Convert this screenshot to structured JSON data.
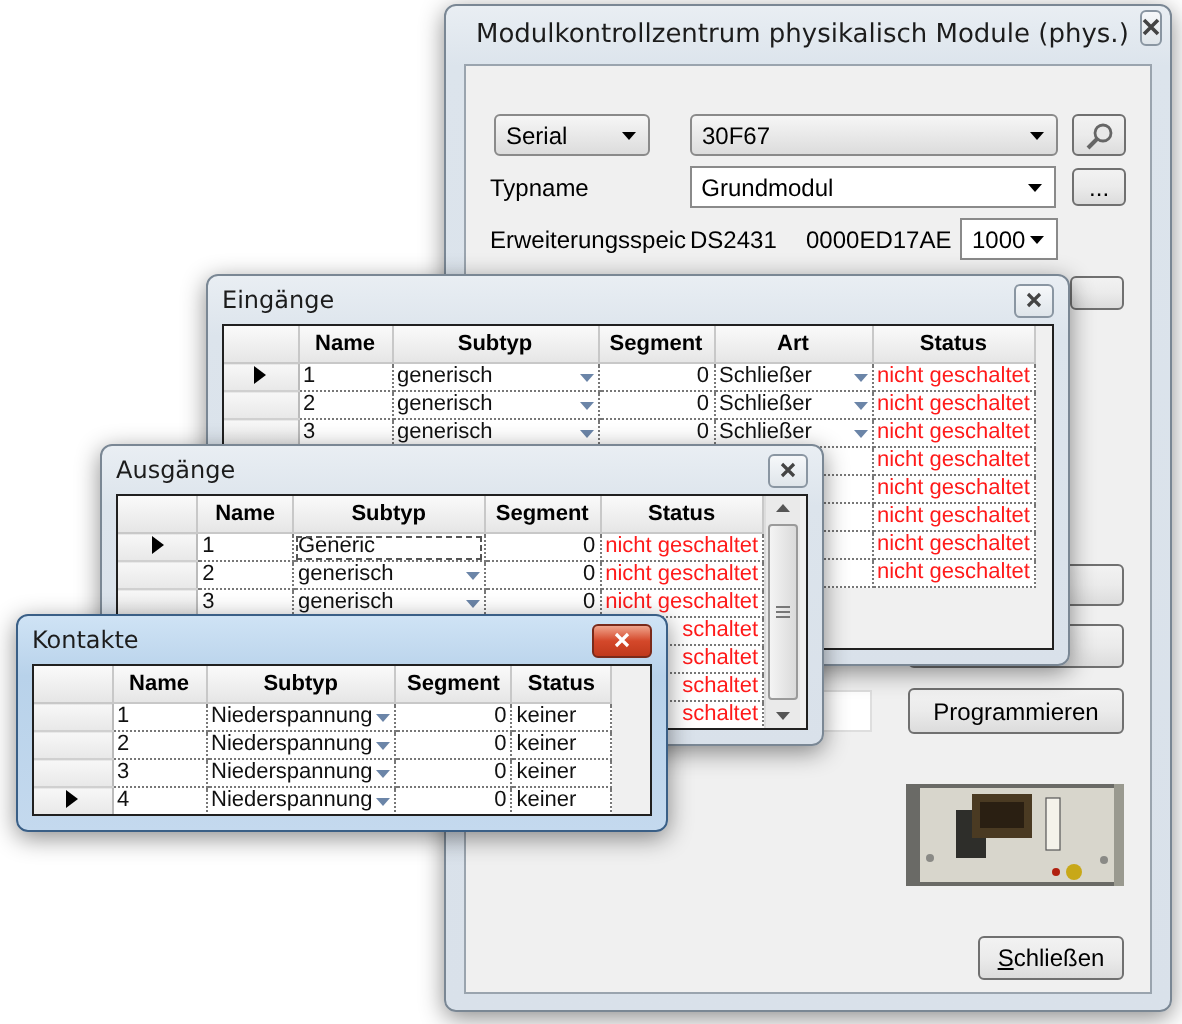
{
  "main_window": {
    "title": "Modulkontrollzentrum physikalisch Module (phys.)",
    "active": false,
    "interface_combo": "Serial",
    "serial_combo": "30F67",
    "typname_label": "Typname",
    "typname_combo": "Grundmodul",
    "browse_button": "...",
    "memory_label": "Erweiterungsspeic",
    "memory_chip": "DS2431",
    "memory_id": "0000ED17AE",
    "memory_size_combo": "1000",
    "program_button": "Programmieren",
    "close_button": "Schließen"
  },
  "windows": [
    {
      "kind": "inputs",
      "title": "Eingänge",
      "active": false,
      "status_alert": true,
      "columns": [
        {
          "label": "Name",
          "kind": "text"
        },
        {
          "label": "Subtyp",
          "kind": "combo"
        },
        {
          "label": "Segment",
          "kind": "number"
        },
        {
          "label": "Art",
          "kind": "combo"
        },
        {
          "label": "Status",
          "kind": "status"
        }
      ],
      "rows": [
        {
          "selected": true,
          "cells": [
            "1",
            "generisch",
            "0",
            "Schließer",
            "nicht geschaltet"
          ]
        },
        {
          "selected": false,
          "cells": [
            "2",
            "generisch",
            "0",
            "Schließer",
            "nicht geschaltet"
          ]
        },
        {
          "selected": false,
          "cells": [
            "3",
            "generisch",
            "0",
            "Schließer",
            "nicht geschaltet"
          ]
        },
        {
          "cells": [
            null,
            null,
            null,
            null,
            "nicht geschaltet"
          ]
        },
        {
          "cells": [
            null,
            null,
            null,
            null,
            "nicht geschaltet"
          ]
        },
        {
          "cells": [
            null,
            null,
            null,
            null,
            "nicht geschaltet"
          ]
        },
        {
          "cells": [
            null,
            null,
            null,
            null,
            "nicht geschaltet"
          ]
        },
        {
          "cells": [
            null,
            null,
            null,
            null,
            "nicht geschaltet"
          ]
        }
      ]
    },
    {
      "kind": "outputs",
      "title": "Ausgänge",
      "active": false,
      "status_alert": true,
      "columns": [
        {
          "label": "Name",
          "kind": "text"
        },
        {
          "label": "Subtyp",
          "kind": "combo"
        },
        {
          "label": "Segment",
          "kind": "number"
        },
        {
          "label": "Status",
          "kind": "status"
        }
      ],
      "rows": [
        {
          "selected": true,
          "editing": true,
          "cells": [
            "1",
            "Generic",
            "0",
            "nicht geschaltet"
          ]
        },
        {
          "selected": false,
          "editing": false,
          "cells": [
            "2",
            "generisch",
            "0",
            "nicht geschaltet"
          ]
        },
        {
          "selected": false,
          "editing": false,
          "cells": [
            "3",
            "generisch",
            "0",
            "nicht geschaltet"
          ]
        },
        {
          "cells": [
            null,
            null,
            null,
            "schaltet"
          ]
        },
        {
          "cells": [
            null,
            null,
            null,
            "schaltet"
          ]
        },
        {
          "cells": [
            null,
            null,
            null,
            "schaltet"
          ]
        },
        {
          "cells": [
            null,
            null,
            null,
            "schaltet"
          ]
        }
      ]
    },
    {
      "kind": "contacts",
      "title": "Kontakte",
      "active": true,
      "status_alert": false,
      "columns": [
        {
          "label": "Name",
          "kind": "text"
        },
        {
          "label": "Subtyp",
          "kind": "combo"
        },
        {
          "label": "Segment",
          "kind": "number"
        },
        {
          "label": "Status",
          "kind": "status"
        }
      ],
      "rows": [
        {
          "selected": false,
          "cells": [
            "1",
            "Niederspannung",
            "0",
            "keiner"
          ]
        },
        {
          "selected": false,
          "cells": [
            "2",
            "Niederspannung",
            "0",
            "keiner"
          ]
        },
        {
          "selected": false,
          "cells": [
            "3",
            "Niederspannung",
            "0",
            "keiner"
          ]
        },
        {
          "selected": true,
          "cells": [
            "4",
            "Niederspannung",
            "0",
            "keiner"
          ]
        }
      ]
    }
  ]
}
